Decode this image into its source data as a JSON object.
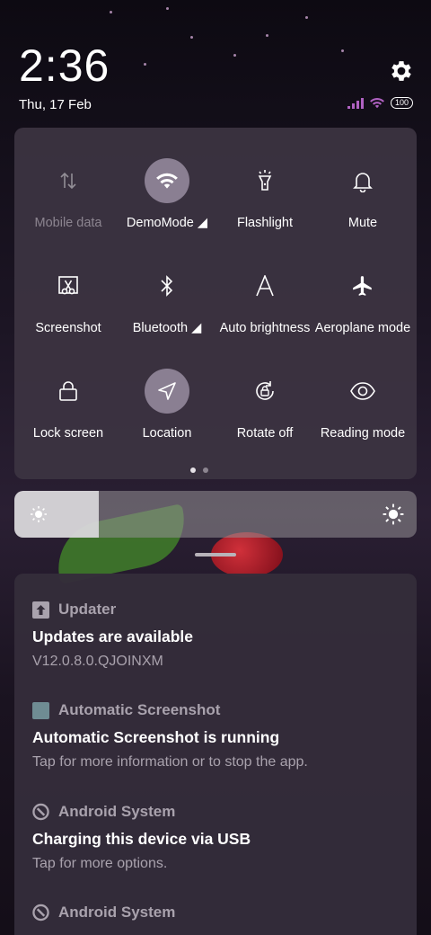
{
  "status": {
    "time": "2:36",
    "date": "Thu, 17 Feb",
    "battery": "100"
  },
  "tiles": [
    {
      "label": "Mobile data",
      "icon": "mobile-data-icon",
      "active": false,
      "disabled": true
    },
    {
      "label": "DemoMode",
      "icon": "wifi-icon",
      "active": true
    },
    {
      "label": "Flashlight",
      "icon": "flashlight-icon",
      "active": false
    },
    {
      "label": "Mute",
      "icon": "bell-icon",
      "active": false
    },
    {
      "label": "Screenshot",
      "icon": "scissors-icon",
      "active": false
    },
    {
      "label": "Bluetooth",
      "icon": "bluetooth-icon",
      "active": false
    },
    {
      "label": "Auto brightness",
      "icon": "auto-brightness-icon",
      "active": false
    },
    {
      "label": "Aeroplane mode",
      "icon": "airplane-icon",
      "active": false
    },
    {
      "label": "Lock screen",
      "icon": "lock-icon",
      "active": false
    },
    {
      "label": "Location",
      "icon": "location-icon",
      "active": true
    },
    {
      "label": "Rotate off",
      "icon": "rotate-lock-icon",
      "active": false
    },
    {
      "label": "Reading mode",
      "icon": "eye-icon",
      "active": false
    }
  ],
  "pager": {
    "pages": 2,
    "current": 1
  },
  "brightness": {
    "level": 0.21
  },
  "notifications": [
    {
      "app": "Updater",
      "title": "Updates are available",
      "text": "V12.0.8.0.QJOINXM",
      "icon": "updater-icon"
    },
    {
      "app": "Automatic Screenshot",
      "title": "Automatic Screenshot is running",
      "text": "Tap for more information or to stop the app.",
      "icon": "app-square-icon"
    },
    {
      "app": "Android System",
      "title": "Charging this device via USB",
      "text": "Tap for more options.",
      "icon": "android-system-icon"
    },
    {
      "app": "Android System",
      "title": "",
      "text": "",
      "icon": "android-system-icon"
    }
  ],
  "colors": {
    "panel": "#3c3442",
    "active_tile": "#8a7f92",
    "muted_text": "#a9a2ad"
  }
}
